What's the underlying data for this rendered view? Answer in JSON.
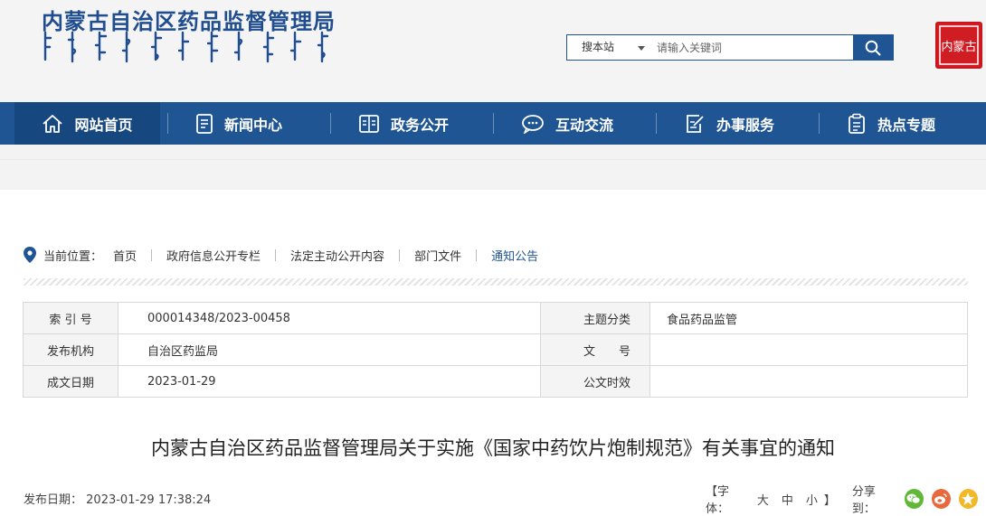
{
  "header": {
    "site_title": "内蒙古自治区药品监督管理局",
    "seal_text": "内蒙古"
  },
  "search": {
    "scope": "搜本站",
    "placeholder": "请输入关键词"
  },
  "nav": {
    "items": [
      {
        "label": "网站首页",
        "icon": "home-icon"
      },
      {
        "label": "新闻中心",
        "icon": "news-icon"
      },
      {
        "label": "政务公开",
        "icon": "document-icon"
      },
      {
        "label": "互动交流",
        "icon": "chat-icon"
      },
      {
        "label": "办事服务",
        "icon": "edit-icon"
      },
      {
        "label": "热点专题",
        "icon": "topic-icon"
      }
    ],
    "active_index": 0
  },
  "breadcrumb": {
    "label": "当前位置：",
    "items": [
      "首页",
      "政府信息公开专栏",
      "法定主动公开内容",
      "部门文件",
      "通知公告"
    ]
  },
  "info": {
    "index_label": "索 引 号",
    "index_value": "000014348/2023-00458",
    "topic_label": "主题分类",
    "topic_value": "食品药品监管",
    "publisher_label": "发布机构",
    "publisher_value": "自治区药监局",
    "docno_label": "文　　号",
    "docno_value": "",
    "date_label": "成文日期",
    "date_value": "2023-01-29",
    "validity_label": "公文时效",
    "validity_value": ""
  },
  "article": {
    "title": "内蒙古自治区药品监督管理局关于实施《国家中药饮片炮制规范》有关事宜的通知",
    "publish_label": "发布日期：",
    "publish_value": "2023-01-29 17:38:24"
  },
  "tools": {
    "font_label": "【字体：",
    "font_large": "大",
    "font_medium": "中",
    "font_small": "小",
    "font_close": "】",
    "share_label": "分享到：",
    "share_targets": [
      "wechat-icon",
      "weibo-icon",
      "qzone-icon"
    ]
  },
  "colors": {
    "brand_blue": "#1f5593",
    "seal_red": "#d01d24",
    "wechat_green": "#5fb836",
    "weibo_orange": "#e8693b",
    "qzone_yellow": "#f3b829"
  }
}
